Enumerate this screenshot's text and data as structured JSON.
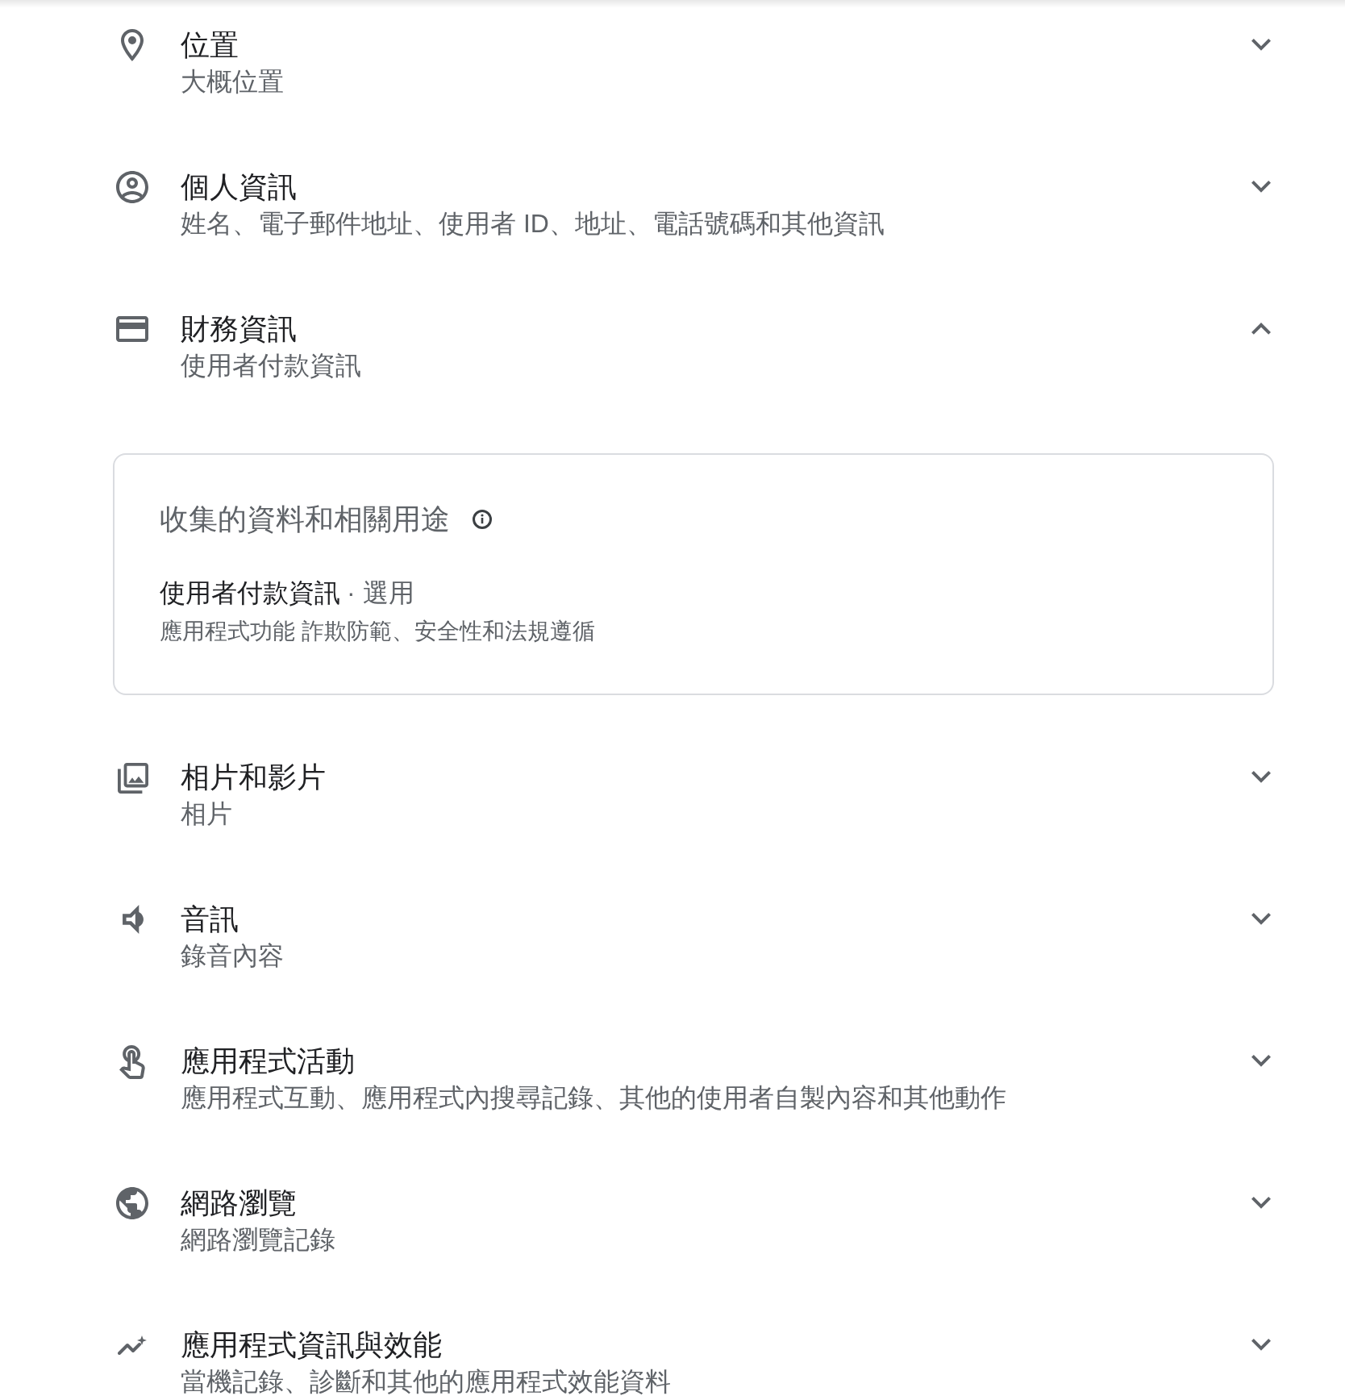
{
  "sections": [
    {
      "title": "位置",
      "subtitle": "大概位置",
      "expanded": false
    },
    {
      "title": "個人資訊",
      "subtitle": "姓名、電子郵件地址、使用者 ID、地址、電話號碼和其他資訊",
      "expanded": false
    },
    {
      "title": "財務資訊",
      "subtitle": "使用者付款資訊",
      "expanded": true,
      "details": {
        "heading": "收集的資料和相關用途",
        "data_types": [
          {
            "name": "使用者付款資訊",
            "requirement": "· 選用",
            "purposes": "應用程式功能 詐欺防範、安全性和法規遵循"
          }
        ]
      }
    },
    {
      "title": "相片和影片",
      "subtitle": "相片",
      "expanded": false
    },
    {
      "title": "音訊",
      "subtitle": "錄音內容",
      "expanded": false
    },
    {
      "title": "應用程式活動",
      "subtitle": "應用程式互動、應用程式內搜尋記錄、其他的使用者自製內容和其他動作",
      "expanded": false
    },
    {
      "title": "網路瀏覽",
      "subtitle": "網路瀏覽記錄",
      "expanded": false
    },
    {
      "title": "應用程式資訊與效能",
      "subtitle": "當機記錄、診斷和其他的應用程式效能資料",
      "expanded": false
    }
  ]
}
